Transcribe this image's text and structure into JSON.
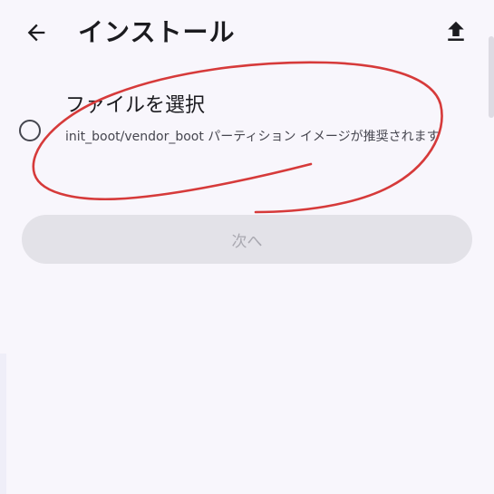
{
  "app_bar": {
    "title": "インストール",
    "back_icon": "arrow-back-icon",
    "upload_icon": "upload-icon"
  },
  "option": {
    "title": "ファイルを選択",
    "description": "init_boot/vendor_boot パーティション イメージが推奨されます",
    "selected": false
  },
  "next_button": {
    "label": "次へ",
    "enabled": false
  },
  "colors": {
    "background": "#f8f6fc",
    "annotation": "#d63a3a",
    "disabled_button": "#e3e2e8"
  }
}
